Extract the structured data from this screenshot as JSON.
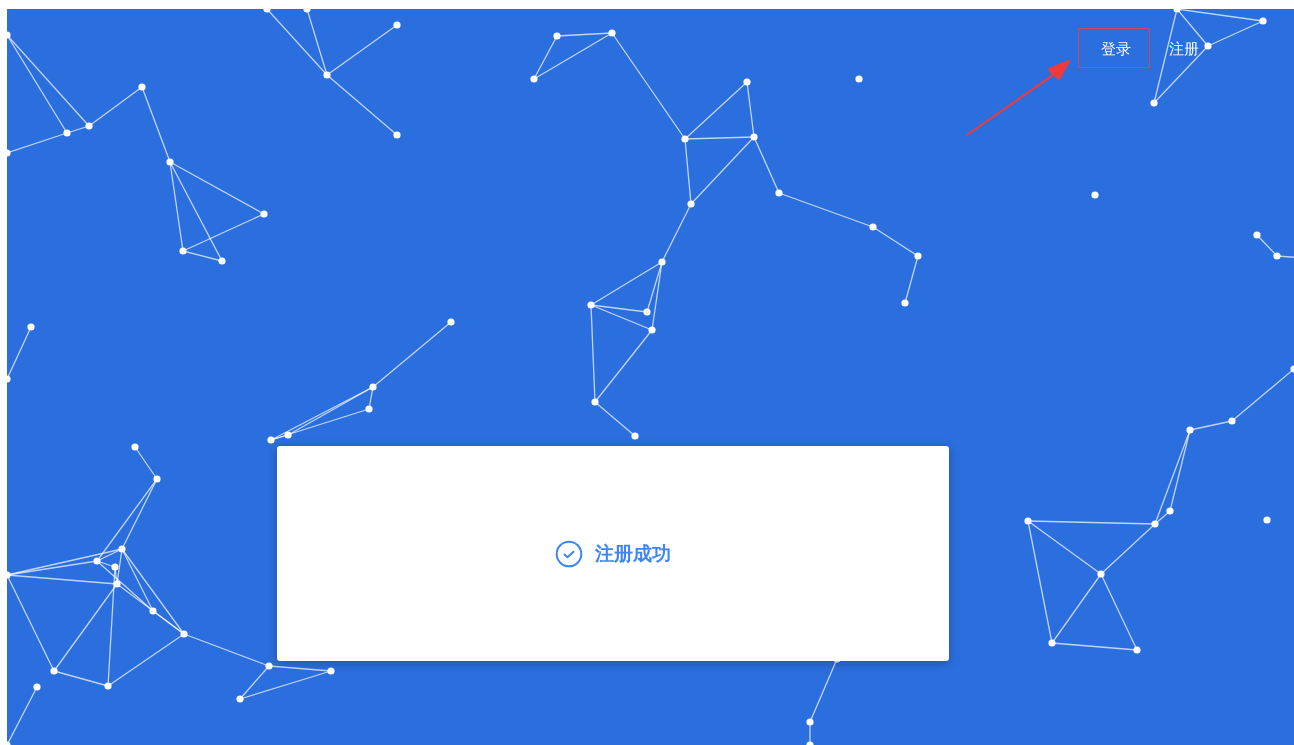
{
  "nav": {
    "links": [
      {
        "label": "登录",
        "highlighted": true
      },
      {
        "label": "注册",
        "highlighted": false
      }
    ]
  },
  "message": {
    "kind": "success",
    "text": "注册成功"
  }
}
